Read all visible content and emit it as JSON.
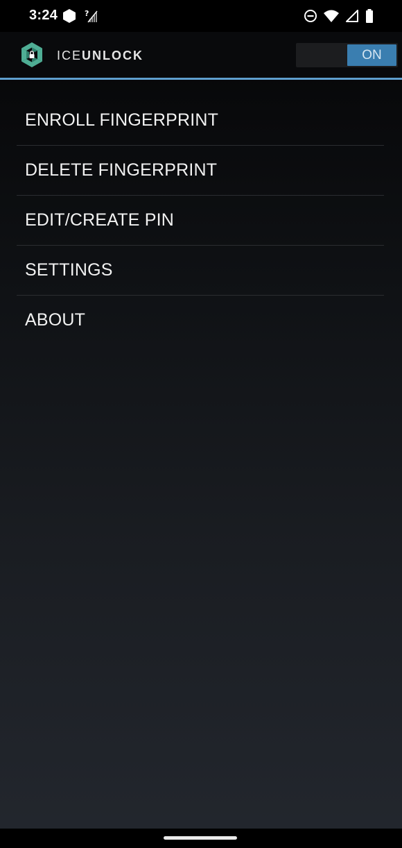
{
  "status_bar": {
    "time": "3:24",
    "left_icons": [
      "shield-icon",
      "no-signal-icon"
    ],
    "right_icons": [
      "do-not-disturb-icon",
      "wifi-icon",
      "cell-signal-icon",
      "battery-icon"
    ]
  },
  "app_bar": {
    "name_part1": "ICE",
    "name_part2": "UNLOCK",
    "toggle_label": "ON",
    "accent_color": "#5f9fcf",
    "logo_color": "#4fae95"
  },
  "menu": {
    "items": [
      {
        "label": "ENROLL FINGERPRINT"
      },
      {
        "label": "DELETE FINGERPRINT"
      },
      {
        "label": "EDIT/CREATE PIN"
      },
      {
        "label": "SETTINGS"
      },
      {
        "label": "ABOUT"
      }
    ]
  }
}
